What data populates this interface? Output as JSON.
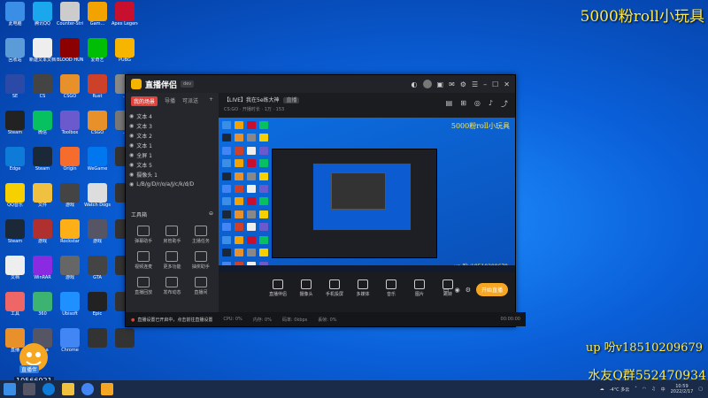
{
  "overlay": {
    "title": "5000粉roll小玩具",
    "up": "up 吩v18510209679",
    "qq": "水友Q群552470934"
  },
  "desktop_icons": [
    {
      "label": "此电脑",
      "color": "#3a8ee6"
    },
    {
      "label": "腾讯QQ",
      "color": "#1aa7ec"
    },
    {
      "label": "Counter-Strike",
      "color": "#ccc"
    },
    {
      "label": "Gam...",
      "color": "#f2a300"
    },
    {
      "label": "Apex Legends",
      "color": "#c8102e"
    },
    {
      "label": "回收站",
      "color": "#5a9bd8"
    },
    {
      "label": "新建文本文档",
      "color": "#eee"
    },
    {
      "label": "BLOOD HUNT",
      "color": "#8b0000"
    },
    {
      "label": "爱奇艺",
      "color": "#00be06"
    },
    {
      "label": "PUBG",
      "color": "#f7b500"
    },
    {
      "label": "SE",
      "color": "#2b4aa8"
    },
    {
      "label": "CS",
      "color": "#444"
    },
    {
      "label": "CSGO",
      "color": "#e8902a"
    },
    {
      "label": "Rust",
      "color": "#cd412b"
    },
    {
      "label": "...",
      "color": "#888"
    },
    {
      "label": "Steam",
      "color": "#222"
    },
    {
      "label": "微信",
      "color": "#07c160"
    },
    {
      "label": "Toolbox",
      "color": "#6a5acd"
    },
    {
      "label": "CSGO",
      "color": "#e8902a"
    },
    {
      "label": "...",
      "color": "#777"
    },
    {
      "label": "Edge",
      "color": "#0f7bd8"
    },
    {
      "label": "Steam",
      "color": "#1b2838"
    },
    {
      "label": "Origin",
      "color": "#f56c2d"
    },
    {
      "label": "WeGame",
      "color": "#0077ee"
    },
    {
      "label": "",
      "color": "#333"
    },
    {
      "label": "QQ音乐",
      "color": "#f7d000"
    },
    {
      "label": "文件",
      "color": "#f0c040"
    },
    {
      "label": "游戏",
      "color": "#444"
    },
    {
      "label": "Watch Dogs",
      "color": "#ddd"
    },
    {
      "label": "",
      "color": "#333"
    },
    {
      "label": "Steam",
      "color": "#1b2838"
    },
    {
      "label": "游戏",
      "color": "#b03030"
    },
    {
      "label": "Rockstar",
      "color": "#fcaf17"
    },
    {
      "label": "游戏",
      "color": "#556"
    },
    {
      "label": "",
      "color": "#333"
    },
    {
      "label": "文档",
      "color": "#eee"
    },
    {
      "label": "WinRAR",
      "color": "#8a2be2"
    },
    {
      "label": "游戏",
      "color": "#666"
    },
    {
      "label": "GTA",
      "color": "#444"
    },
    {
      "label": "",
      "color": "#333"
    },
    {
      "label": "工具",
      "color": "#e66"
    },
    {
      "label": "360",
      "color": "#3cb371"
    },
    {
      "label": "Ubisoft",
      "color": "#1e90ff"
    },
    {
      "label": "Epic",
      "color": "#222"
    },
    {
      "label": "",
      "color": "#333"
    },
    {
      "label": "直播",
      "color": "#e8902a"
    },
    {
      "label": "Arma",
      "color": "#556"
    },
    {
      "label": "Chrome",
      "color": "#4285f4"
    },
    {
      "label": "",
      "color": "#333"
    },
    {
      "label": "",
      "color": "#333"
    }
  ],
  "brand": {
    "tag": "直播伴",
    "id": "10566921"
  },
  "app": {
    "name": "直播伴侣",
    "version": "dev",
    "tabs": [
      "我的场景",
      "导播",
      "可派送"
    ],
    "scenes": [
      "文本 4",
      "文本 3",
      "文本 2",
      "文本 1",
      "全屏 1",
      "文本 5",
      "摄像头 1",
      "L/B/g/D/r/o/a/J/c/k/d/D"
    ],
    "toolbox_title": "工具箱",
    "tools": [
      "弹幕助手",
      "房管助手",
      "主播任务",
      "视频连麦",
      "更多功能",
      "抽奖助手",
      "直播回放",
      "发布动态",
      "直播间"
    ],
    "room_title": "【LIVE】我在5e练大神",
    "room_tag": "直播",
    "room_sub": "CS:GO · 开播时长 · 1万 · 153",
    "controls": [
      "直播伴侣",
      "摄像头",
      "手机投屏",
      "多媒体",
      "音乐",
      "图片",
      "跳转"
    ],
    "go_live": "开始直播",
    "status_warn": "直播设置已开启中，点击前往直播设置",
    "status_items": [
      "CPU: 0%",
      "内存: 0%",
      "码率: 0kbps",
      "丢帧: 0%"
    ],
    "status_time": "00:00:00"
  },
  "taskbar": {
    "weather": "-4°C 多云",
    "lang": "中",
    "time": "10:59",
    "date": "2022/2/17"
  }
}
